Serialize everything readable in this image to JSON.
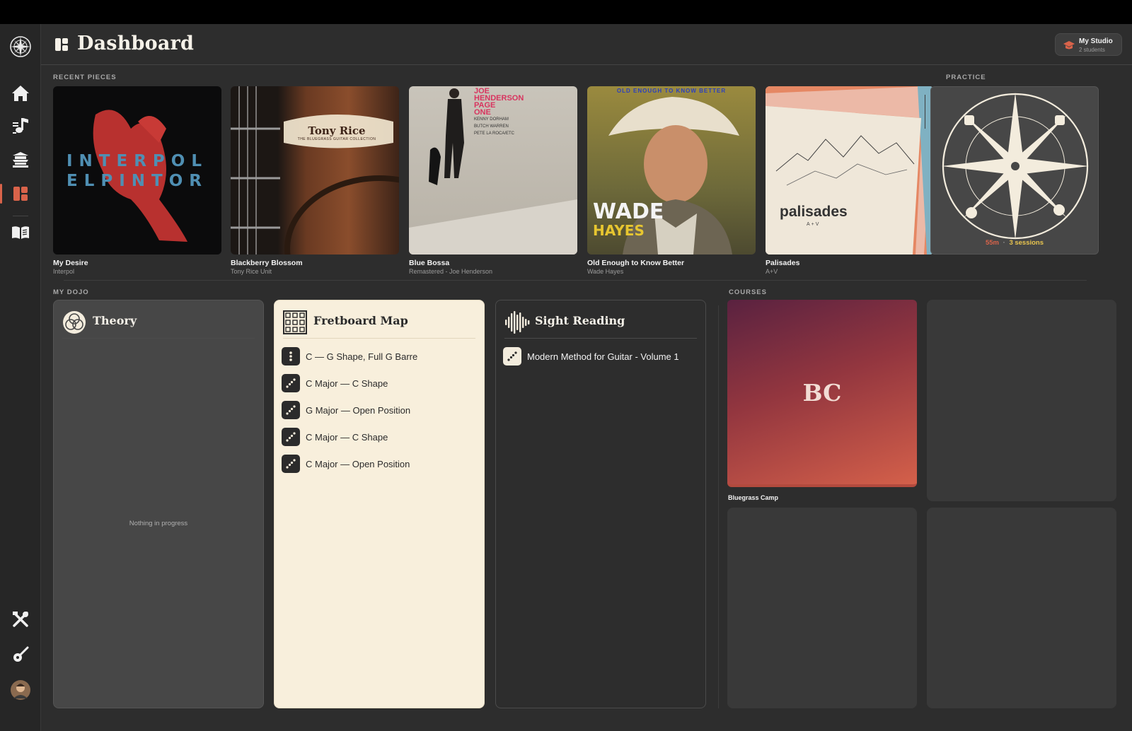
{
  "header": {
    "title": "Dashboard",
    "studio": {
      "name": "My Studio",
      "subtitle": "2 students"
    }
  },
  "sidebar": {
    "items": [
      {
        "name": "logo",
        "icon": "compass-star-icon"
      },
      {
        "name": "home",
        "icon": "home-icon"
      },
      {
        "name": "pieces",
        "icon": "music-note-icon"
      },
      {
        "name": "dojo",
        "icon": "pagoda-icon"
      },
      {
        "name": "dashboard",
        "icon": "dashboard-icon",
        "active": true
      },
      {
        "name": "courses",
        "icon": "open-book-icon"
      },
      {
        "name": "tools",
        "icon": "tools-icon"
      },
      {
        "name": "guitar",
        "icon": "guitar-icon"
      },
      {
        "name": "profile",
        "icon": "avatar"
      }
    ]
  },
  "sections": {
    "recent": "RECENT PIECES",
    "practice": "PRACTICE",
    "dojo": "MY DOJO",
    "courses": "COURSES"
  },
  "recent_pieces": [
    {
      "title": "My Desire",
      "artist": "Interpol",
      "cover_text": [
        "INTERPOL",
        "ELPINTOR"
      ]
    },
    {
      "title": "Blackberry Blossom",
      "artist": "Tony Rice Unit",
      "cover_text": [
        "Tony Rice",
        "THE BLUEGRASS GUITAR COLLECTION"
      ]
    },
    {
      "title": "Blue Bossa",
      "artist": "Remastered - Joe Henderson",
      "cover_text": [
        "JOE",
        "HENDERSON",
        "PAGE",
        "ONE",
        "KENNY DORHAM",
        "BUTCH WARREN",
        "PETE LA ROCA/ETC"
      ]
    },
    {
      "title": "Old Enough to Know Better",
      "artist": "Wade Hayes",
      "cover_text": [
        "OLD ENOUGH TO KNOW BETTER",
        "WADE",
        "HAYES"
      ]
    },
    {
      "title": "Palisades",
      "artist": "A+V",
      "cover_text": [
        "palisades",
        "A+V"
      ]
    }
  ],
  "practice": {
    "minutes": "55m",
    "separator": "·",
    "sessions": "3 sessions"
  },
  "dojo": {
    "theory": {
      "title": "Theory",
      "empty": "Nothing in progress"
    },
    "fretboard": {
      "title": "Fretboard Map",
      "items": [
        "C — G Shape, Full G Barre",
        "C Major — C Shape",
        "G Major — Open Position",
        "C Major — C Shape",
        "C Major — Open Position"
      ]
    },
    "sight_reading": {
      "title": "Sight Reading",
      "items": [
        "Modern Method for Guitar - Volume 1"
      ]
    }
  },
  "courses": [
    {
      "abbr": "BC",
      "title": "Bluegrass Camp"
    }
  ],
  "colors": {
    "accent": "#d9634a",
    "cream": "#f8efdc",
    "panel": "#2d2d2d"
  }
}
